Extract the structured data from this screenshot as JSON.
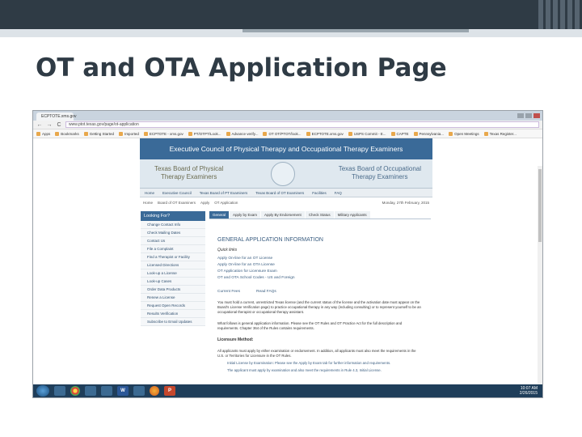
{
  "slide": {
    "title": "OT and OTA Application Page"
  },
  "browser": {
    "tab_label": "ECPTOTE.xms.gov",
    "url": "www.ptot.texas.gov/page/ot-application",
    "back_label": "←",
    "forward_label": "→",
    "reload_label": "C",
    "bookmarks": [
      "Apps",
      "Bookmarks",
      "Getting Started",
      "Imported",
      "ECPTOTE - xms.gov",
      "PT/OTPT/Look...",
      "Advance verify...",
      "OT OT/PTOT/look...",
      "ECPTOTE.xms.gov",
      "USPS Commit - E...",
      "CAPTE",
      "Pennsylvania...",
      "Open Meetings",
      "Texas Register..."
    ]
  },
  "site": {
    "banner_title": "Executive Council of Physical Therapy and Occupational Therapy Examiners",
    "board_pt_line1": "Texas Board of Physical",
    "board_pt_line2": "Therapy Examiners",
    "board_ot_line1": "Texas Board of Occupational",
    "board_ot_line2": "Therapy Examiners",
    "nav": [
      "Home",
      "Executive Council",
      "Texas Board of PT Examiners",
      "Texas Board of OT Examiners",
      "Facilities",
      "FAQ"
    ],
    "breadcrumb": [
      "Home",
      "Board of OT Examiners",
      "Apply",
      "OT Application"
    ],
    "date": "Monday, 27th February, 2015"
  },
  "sidebar": {
    "heading": "Looking For?",
    "items": [
      "Change Contact Info",
      "Check Mailing Dates",
      "Contact Us",
      "File a Complaint",
      "Find a Therapist or Facility",
      "Licensed Directions",
      "Look-up a License",
      "Look-up Cases",
      "Order Data Products",
      "Renew a License",
      "Request Open Records",
      "Results Verification",
      "Subscribe to Email Updates"
    ]
  },
  "content": {
    "tabs": [
      "General",
      "Apply by Exam",
      "Apply By Endorsement",
      "Check Status",
      "Military Applicants"
    ],
    "title": "GENERAL APPLICATION INFORMATION",
    "quick_links_label": "Quick links",
    "links": [
      "Apply On-line for an OT License",
      "Apply On-line for an OTA License",
      "OT Application for Licensure Exam",
      "OT and OTA School Codes - US and Foreign"
    ],
    "fees_label": "Current Fees",
    "faqs_label": "Read FAQs",
    "para1": "You must hold a current, unrestricted Texas license (and the current status of the license and the activation date must appear on the Board's License Verification page) to practice occupational therapy in any way (including consulting) or to represent yourself to be an occupational therapist or occupational therapy assistant.",
    "para2": "What follows is general application information. Please see the OT Rules and OT Practice Act for the full description and requirements. Chapter 364 of the Rules contains requirements.",
    "licensure_heading": "Licensure Method:",
    "para3": "All applicants must apply by either examination or endorsement. In addition, all applicants must also meet the requirements in the U.S. or Territories for Licensure in the OT Rules.",
    "bullet1": "Initial License by Examination: Please see the Apply by Exam tab for further information and requirements.",
    "bullet2": "The applicant must apply by examination and also meet the requirements in Rule 4.3, Initial License."
  },
  "taskbar": {
    "word_label": "W",
    "ppt_label": "P",
    "time": "10:07 AM",
    "date": "2/26/2015"
  }
}
